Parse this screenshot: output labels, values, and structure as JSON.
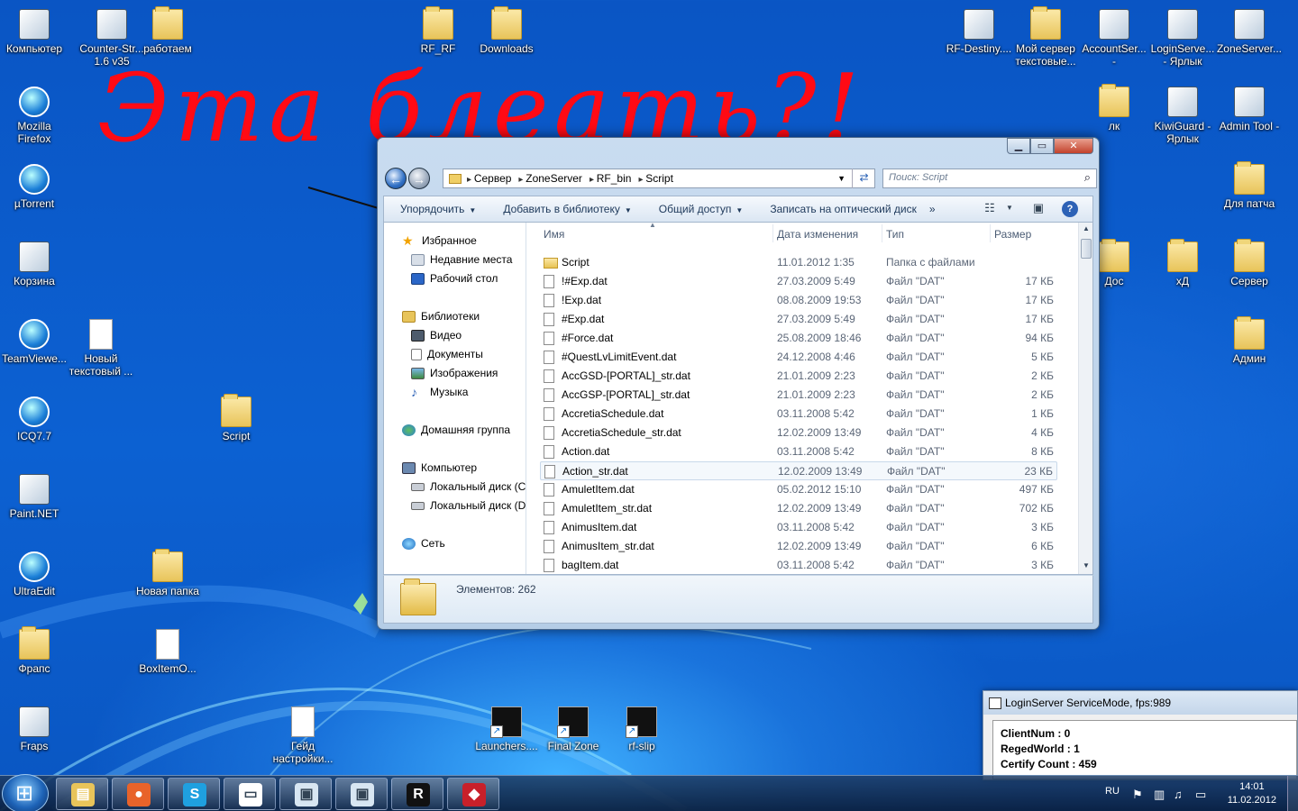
{
  "scrawl_text": "Эта блеать?!",
  "desktop_icons": [
    {
      "label": "Компьютер",
      "kind": "app"
    },
    {
      "label": "Counter-Str... 1.6 v35",
      "kind": "app"
    },
    {
      "label": "работаем",
      "kind": "folder"
    },
    {
      "label": "RF_RF",
      "kind": "folder"
    },
    {
      "label": "Downloads",
      "kind": "folder"
    },
    {
      "label": "RF-Destiny....",
      "kind": "app"
    },
    {
      "label": "Мой сервер текстовые...",
      "kind": "folder"
    },
    {
      "label": "AccountSer... -",
      "kind": "app"
    },
    {
      "label": "LoginServe... - Ярлык",
      "kind": "app"
    },
    {
      "label": "ZoneServer...",
      "kind": "app"
    },
    {
      "label": "Mozilla Firefox",
      "kind": "round"
    },
    {
      "label": "лк",
      "kind": "folder"
    },
    {
      "label": "KiwiGuard - Ярлык",
      "kind": "app"
    },
    {
      "label": "Admin Tool -",
      "kind": "app"
    },
    {
      "label": "µTorrent",
      "kind": "round"
    },
    {
      "label": "Для патча",
      "kind": "folder"
    },
    {
      "label": "Корзина",
      "kind": "app"
    },
    {
      "label": "Дос",
      "kind": "folder"
    },
    {
      "label": "хД",
      "kind": "folder"
    },
    {
      "label": "Сервер",
      "kind": "folder"
    },
    {
      "label": "TeamViewe...",
      "kind": "round"
    },
    {
      "label": "Новый текстовый ...",
      "kind": "doc"
    },
    {
      "label": "Админ",
      "kind": "folder"
    },
    {
      "label": "ICQ7.7",
      "kind": "round"
    },
    {
      "label": "Script",
      "kind": "folder"
    },
    {
      "label": "Paint.NET",
      "kind": "app"
    },
    {
      "label": "UltraEdit",
      "kind": "round"
    },
    {
      "label": "Новая папка",
      "kind": "folder"
    },
    {
      "label": "Фрапс",
      "kind": "folder"
    },
    {
      "label": "BoxItemO...",
      "kind": "doc"
    },
    {
      "label": "Fraps",
      "kind": "app"
    },
    {
      "label": "Гейд настройки...",
      "kind": "doc"
    },
    {
      "label": "Launchers....",
      "kind": "dark"
    },
    {
      "label": "Final Zone",
      "kind": "dark"
    },
    {
      "label": "rf-slip",
      "kind": "dark"
    }
  ],
  "explorer": {
    "breadcrumb": [
      "Сервер",
      "ZoneServer",
      "RF_bin",
      "Script"
    ],
    "search_placeholder": "Поиск: Script",
    "toolbar": {
      "organize": "Упорядочить",
      "add_library": "Добавить в библиотеку",
      "share": "Общий доступ",
      "burn": "Записать на оптический диск",
      "more": "»"
    },
    "nav": {
      "favorites": "Избранное",
      "recent": "Недавние места",
      "desktop": "Рабочий стол",
      "libraries": "Библиотеки",
      "video": "Видео",
      "documents": "Документы",
      "images": "Изображения",
      "music": "Музыка",
      "homegroup": "Домашняя группа",
      "computer": "Компьютер",
      "disk_c": "Локальный диск (C",
      "disk_d": "Локальный диск (D",
      "network": "Сеть"
    },
    "columns": {
      "name": "Имя",
      "date": "Дата изменения",
      "type": "Тип",
      "size": "Размер"
    },
    "files": [
      {
        "name": "Script",
        "date": "11.01.2012 1:35",
        "type": "Папка с файлами",
        "size": "",
        "folder": true
      },
      {
        "name": "!#Exp.dat",
        "date": "27.03.2009 5:49",
        "type": "Файл \"DAT\"",
        "size": "17 КБ"
      },
      {
        "name": "!Exp.dat",
        "date": "08.08.2009 19:53",
        "type": "Файл \"DAT\"",
        "size": "17 КБ"
      },
      {
        "name": "#Exp.dat",
        "date": "27.03.2009 5:49",
        "type": "Файл \"DAT\"",
        "size": "17 КБ"
      },
      {
        "name": "#Force.dat",
        "date": "25.08.2009 18:46",
        "type": "Файл \"DAT\"",
        "size": "94 КБ"
      },
      {
        "name": "#QuestLvLimitEvent.dat",
        "date": "24.12.2008 4:46",
        "type": "Файл \"DAT\"",
        "size": "5 КБ"
      },
      {
        "name": "AccGSD-[PORTAL]_str.dat",
        "date": "21.01.2009 2:23",
        "type": "Файл \"DAT\"",
        "size": "2 КБ"
      },
      {
        "name": "AccGSP-[PORTAL]_str.dat",
        "date": "21.01.2009 2:23",
        "type": "Файл \"DAT\"",
        "size": "2 КБ"
      },
      {
        "name": "AccretiaSchedule.dat",
        "date": "03.11.2008 5:42",
        "type": "Файл \"DAT\"",
        "size": "1 КБ"
      },
      {
        "name": "AccretiaSchedule_str.dat",
        "date": "12.02.2009 13:49",
        "type": "Файл \"DAT\"",
        "size": "4 КБ"
      },
      {
        "name": "Action.dat",
        "date": "03.11.2008 5:42",
        "type": "Файл \"DAT\"",
        "size": "8 КБ"
      },
      {
        "name": "Action_str.dat",
        "date": "12.02.2009 13:49",
        "type": "Файл \"DAT\"",
        "size": "23 КБ"
      },
      {
        "name": "AmuletItem.dat",
        "date": "05.02.2012 15:10",
        "type": "Файл \"DAT\"",
        "size": "497 КБ"
      },
      {
        "name": "AmuletItem_str.dat",
        "date": "12.02.2009 13:49",
        "type": "Файл \"DAT\"",
        "size": "702 КБ"
      },
      {
        "name": "AnimusItem.dat",
        "date": "03.11.2008 5:42",
        "type": "Файл \"DAT\"",
        "size": "3 КБ"
      },
      {
        "name": "AnimusItem_str.dat",
        "date": "12.02.2009 13:49",
        "type": "Файл \"DAT\"",
        "size": "6 КБ"
      },
      {
        "name": "bagItem.dat",
        "date": "03.11.2008 5:42",
        "type": "Файл \"DAT\"",
        "size": "3 КБ"
      }
    ],
    "selected_index": 11,
    "status": "Элементов: 262"
  },
  "login_server": {
    "title": "LoginServer ServiceMode, fps:989",
    "lines": [
      "ClientNum : 0",
      "RegedWorld : 1",
      "Certify Count : 459"
    ]
  },
  "taskbar": {
    "apps": [
      "explorer",
      "firefox",
      "skype",
      "folder",
      "window",
      "window",
      "rf-game",
      "kiwiguard"
    ],
    "lang": "RU",
    "time": "14:01",
    "date": "11.02.2012"
  },
  "colors": {
    "scrawl": "#ff0a14",
    "desktop": "#0c61d2"
  }
}
